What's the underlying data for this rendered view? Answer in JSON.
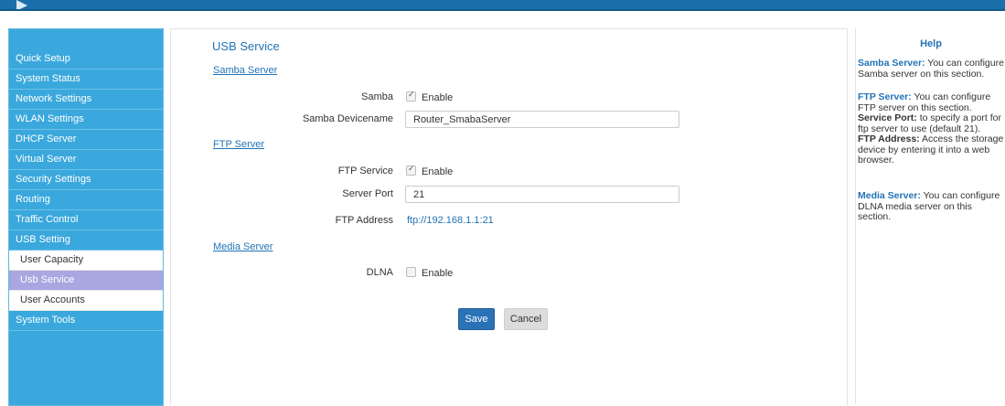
{
  "sidebar": {
    "items": [
      {
        "label": "Quick Setup"
      },
      {
        "label": "System Status"
      },
      {
        "label": "Network Settings"
      },
      {
        "label": "WLAN Settings"
      },
      {
        "label": "DHCP Server"
      },
      {
        "label": "Virtual Server"
      },
      {
        "label": "Security Settings"
      },
      {
        "label": "Routing"
      },
      {
        "label": "Traffic Control"
      },
      {
        "label": "USB Setting"
      }
    ],
    "sub_items": [
      {
        "label": "User Capacity"
      },
      {
        "label": "Usb Service",
        "active": true
      },
      {
        "label": "User Accounts"
      }
    ],
    "tail_item": {
      "label": "System Tools"
    }
  },
  "main": {
    "title": "USB Service",
    "samba": {
      "section": "Samba Server",
      "samba_label": "Samba",
      "samba_enable": "Enable",
      "samba_checked": true,
      "devicename_label": "Samba Devicename",
      "devicename_value": "Router_SmabaServer"
    },
    "ftp": {
      "section": "FTP Server",
      "service_label": "FTP Service",
      "service_enable": "Enable",
      "service_checked": true,
      "port_label": "Server Port",
      "port_value": "21",
      "address_label": "FTP Address",
      "address_value": "ftp://192.168.1.1:21"
    },
    "media": {
      "section": "Media Server",
      "dlna_label": "DLNA",
      "dlna_enable": "Enable",
      "dlna_checked": false
    },
    "buttons": {
      "save": "Save",
      "cancel": "Cancel"
    }
  },
  "help": {
    "title": "Help",
    "samba_term": "Samba Server:",
    "samba_text": " You can configure Samba server on this section.",
    "ftp_term": "FTP Server:",
    "ftp_text": " You can configure FTP server on this section.",
    "port_term": "Service Port:",
    "port_text": " to specify a port for ftp server to use (default 21).",
    "addr_term": "FTP Address:",
    "addr_text": " Access the storage device by entering it into a web browser.",
    "media_term": "Media Server:",
    "media_text": " You can configure DLNA media server on this section."
  },
  "colors": {
    "accent": "#2273b6",
    "sidebar": "#3aa8dc",
    "active_sub": "#a9a6e0",
    "topbar": "#1b6fab"
  }
}
